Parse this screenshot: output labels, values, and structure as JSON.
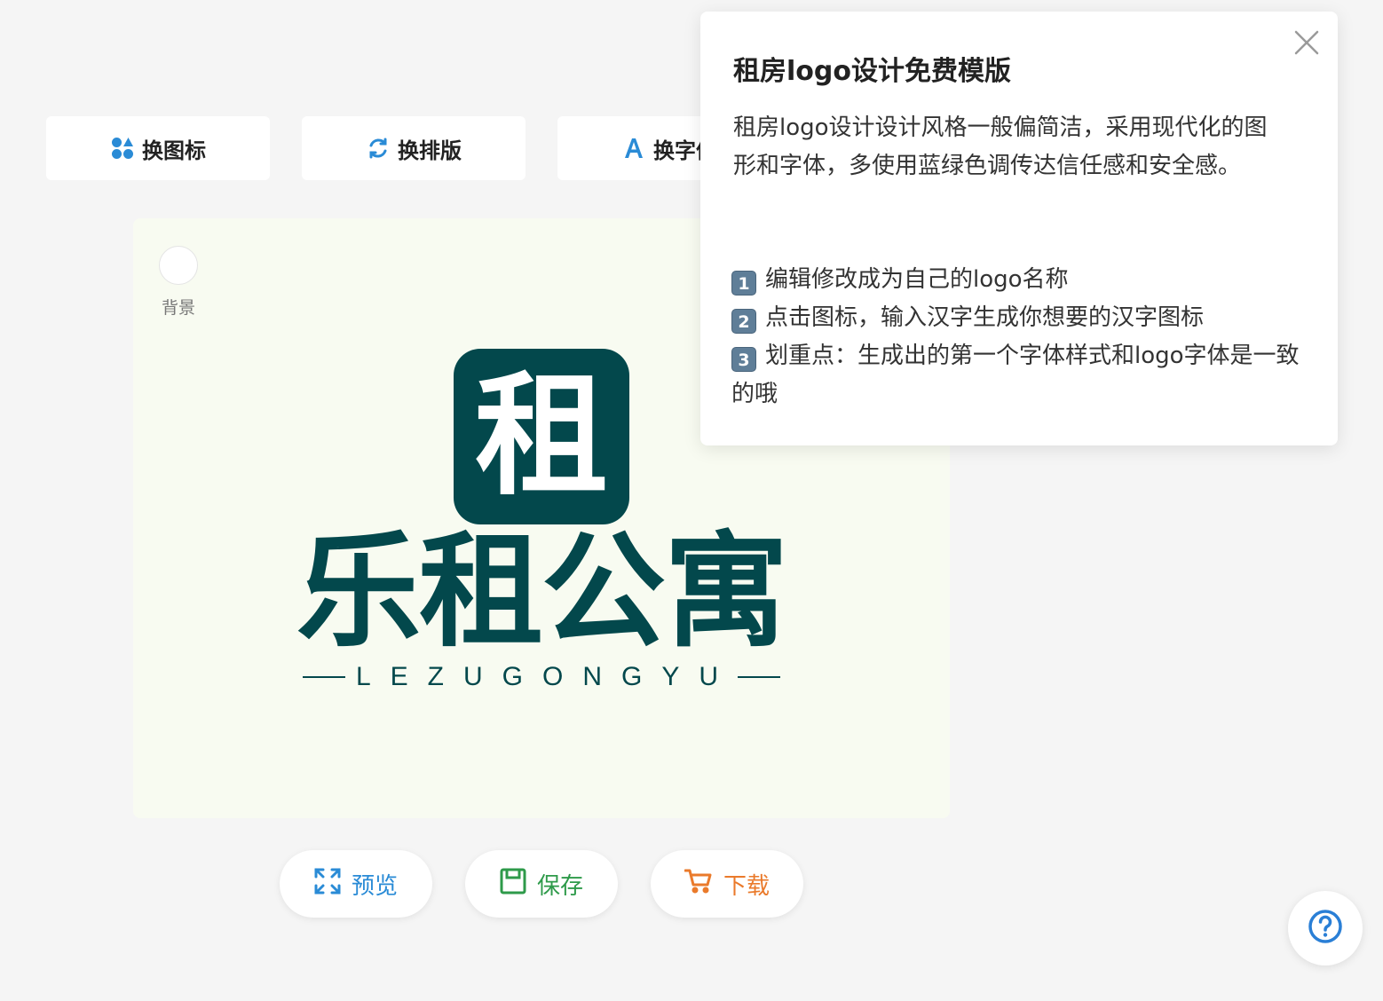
{
  "toolbar": {
    "change_icon": "换图标",
    "change_layout": "换排版",
    "change_font": "换字体"
  },
  "canvas": {
    "background_label": "背景",
    "logo_char": "租",
    "brand_name": "乐租公寓",
    "brand_sub": "LEZUGONGYU"
  },
  "actions": {
    "preview": "预览",
    "save": "保存",
    "download": "下载"
  },
  "popover": {
    "title": "租房logo设计免费模版",
    "description": "租房logo设计设计风格一般偏简洁，采用现代化的图形和字体，多使用蓝绿色调传达信任感和安全感。",
    "steps": [
      {
        "num": "1",
        "text": "编辑修改成为自己的logo名称"
      },
      {
        "num": "2",
        "text": "点击图标，输入汉字生成你想要的汉字图标"
      },
      {
        "num": "3",
        "text": "划重点：生成出的第一个字体样式和logo字体是一致的哦"
      }
    ]
  },
  "colors": {
    "brand": "#03484c",
    "canvas_bg": "#f8fbf1",
    "accent_blue": "#2a8bd6",
    "accent_green": "#2e9a4a",
    "accent_orange": "#ea7a2b"
  },
  "icons": [
    "shapes-icon",
    "refresh-icon",
    "font-icon",
    "expand-icon",
    "save-icon",
    "cart-icon",
    "help-icon",
    "close-icon"
  ]
}
